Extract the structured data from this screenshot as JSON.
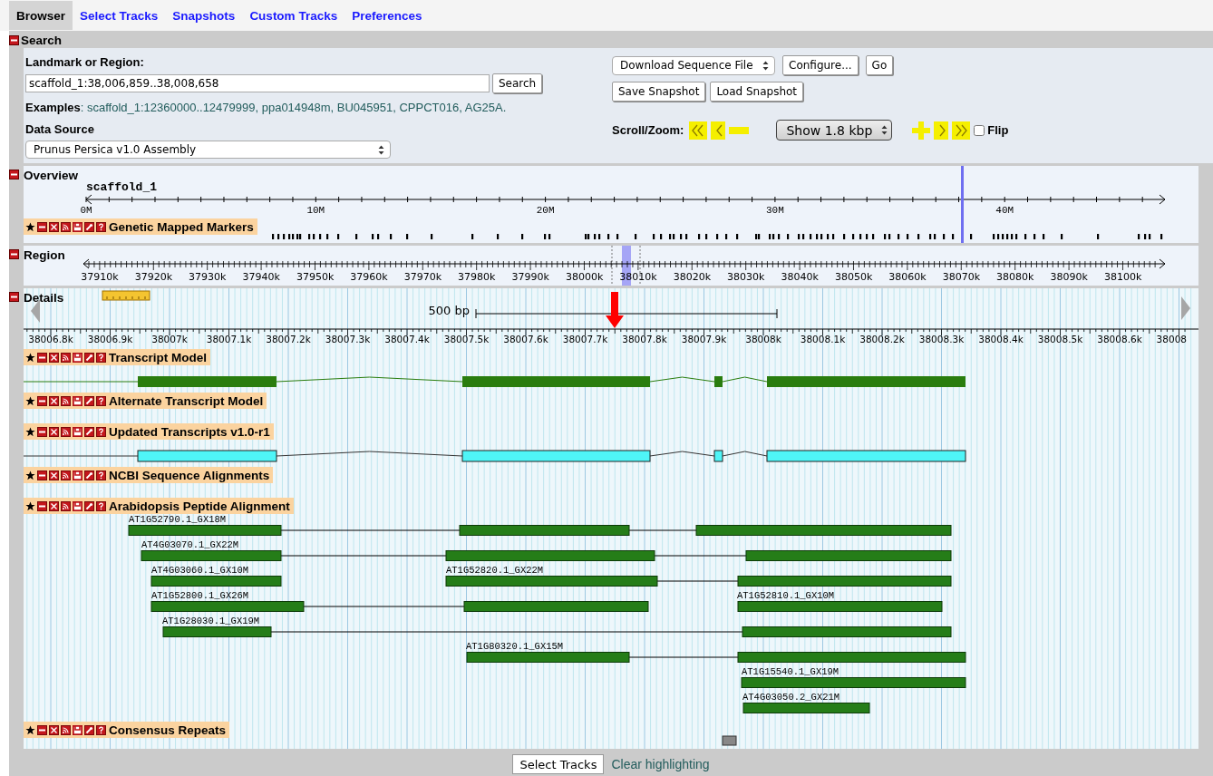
{
  "tabs": [
    {
      "label": "Browser",
      "selected": true
    },
    {
      "label": "Select Tracks",
      "selected": false
    },
    {
      "label": "Snapshots",
      "selected": false
    },
    {
      "label": "Custom Tracks",
      "selected": false
    },
    {
      "label": "Preferences",
      "selected": false
    }
  ],
  "search": {
    "title": "Search",
    "landmark_label": "Landmark or Region:",
    "landmark_value": "scaffold_1:38,006,859..38,008,658",
    "search_button": "Search",
    "examples": "**Examples**: scaffold_1:12360000..12479999, ppa014948m, BU045951, CPPCT016, AG25A.",
    "data_source_label": "Data Source",
    "data_source": "Prunus Persica v1.0 Assembly",
    "download_select": "Download Sequence File",
    "configure_button": "Configure...",
    "go_button": "Go",
    "save_snapshot": "Save Snapshot",
    "load_snapshot": "Load Snapshot",
    "scroll_zoom_label": "Scroll/Zoom:",
    "zoom_select": "Show 1.8 kbp",
    "flip": {
      "label": "Flip",
      "checked": false
    }
  },
  "overview": {
    "title": "Overview",
    "chromosome": "scaffold_1",
    "ticks": [
      "0M",
      "10M",
      "20M",
      "30M",
      "40M"
    ],
    "track": "Genetic Mapped Markers"
  },
  "region": {
    "title": "Region",
    "ticks": [
      "37910k",
      "37920k",
      "37930k",
      "37940k",
      "37950k",
      "37960k",
      "37970k",
      "37980k",
      "37990k",
      "38000k",
      "38010k",
      "38020k",
      "38030k",
      "38040k",
      "38050k",
      "38060k",
      "38070k",
      "38080k",
      "38090k",
      "38100k"
    ]
  },
  "details": {
    "title": "Details",
    "scale": "500 bp",
    "ticks": [
      "38006.8k",
      "38006.9k",
      "38007k",
      "38007.1k",
      "38007.2k",
      "38007.3k",
      "38007.4k",
      "38007.5k",
      "38007.6k",
      "38007.7k",
      "38007.8k",
      "38007.9k",
      "38008k",
      "38008.1k",
      "38008.2k",
      "38008.3k",
      "38008.4k",
      "38008.5k",
      "38008.6k",
      "38008"
    ],
    "tracks": [
      {
        "name": "Transcript Model",
        "kind": "transcript",
        "color": "#2a7d0e"
      },
      {
        "name": "Alternate Transcript Model",
        "kind": "empty"
      },
      {
        "name": "Updated Transcripts v1.0-r1",
        "kind": "transcript",
        "color": "#4ff5f7"
      },
      {
        "name": "NCBI Sequence Alignments",
        "kind": "empty"
      },
      {
        "name": "Arabidopsis Peptide Alignment",
        "kind": "alignments",
        "labels": [
          "AT1G52790.1_GX18M",
          "AT4G03070.1_GX22M",
          "AT4G03060.1_GX10M",
          "AT1G52820.1_GX22M",
          "AT1G52800.1_GX26M",
          "AT1G52810.1_GX10M",
          "AT1G28030.1_GX19M",
          "AT1G80320.1_GX15M",
          "AT1G15540.1_GX19M",
          "AT4G03050.2_GX21M"
        ]
      },
      {
        "name": "Consensus Repeats",
        "kind": "repeats"
      }
    ]
  },
  "footer": {
    "select_tracks": "Select Tracks",
    "clear_highlighting": "Clear highlighting"
  }
}
